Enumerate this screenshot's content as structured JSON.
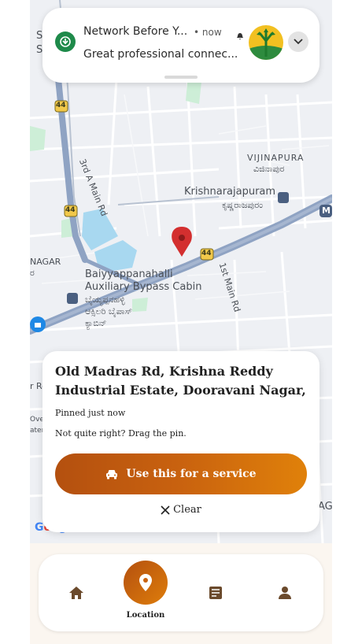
{
  "notification": {
    "app_title": "Network Before Y...",
    "time": "• now",
    "body": "Great professional connec...",
    "icon": "network-app-icon",
    "large_icon": "road-split-logo"
  },
  "map": {
    "labels": {
      "vijinapura_en": "VIJINAPURA",
      "vijinapura_kn": "ವಿಜಿನಾಪುರ",
      "krishnarajapuram_en": "Krishnarajapuram",
      "krishnarajapuram_kn": "ಕೃಷ್ಣರಾಜಪುರಂ",
      "third_a_main": "3rd A Main Rd",
      "first_main": "1st Main Rd",
      "nagar": "NAGAR",
      "nagar_kn": "ರ",
      "baiyyappanahalli_1": "Baiyyappanahalli",
      "baiyyappanahalli_2": "Auxiliary Bypass Cabin",
      "baiyyappanahalli_kn_1": "ಬೈಯ್ಯಪ್ಪನಹಳ್ಳಿ",
      "baiyyappanahalli_kn_2": "ಆಕ್ಸಿಲರಿ ಬೈಪಾಸ್",
      "baiyyappanahalli_kn_3": "ಕ್ಯಾಬಿನ್",
      "shield_44_a": "44",
      "shield_44_b": "44",
      "shield_44_c": "44",
      "metro": "M",
      "edge_r": "r Ro",
      "edge_over": "Over",
      "edge_ater": "ater",
      "edge_ag": "AG",
      "edge_s1": "S",
      "edge_s2": "S"
    },
    "google": "Google"
  },
  "card": {
    "address_line1": "Old Madras Rd, Krishna Reddy",
    "address_line2": "Industrial Estate, Dooravani Nagar, Be...",
    "pinned": "Pinned just now",
    "hint": "Not quite right? Drag the pin.",
    "cta_label": "Use this for a service",
    "clear_label": "Clear"
  },
  "nav": {
    "items": [
      {
        "name": "home",
        "icon": "home-icon"
      },
      {
        "name": "location",
        "icon": "location-pin-icon",
        "label": "Location"
      },
      {
        "name": "bookings",
        "icon": "list-icon"
      },
      {
        "name": "profile",
        "icon": "person-icon"
      }
    ]
  },
  "colors": {
    "accent": "#c05a0f",
    "pin": "#d32f2f",
    "road_major": "#8fa3c3",
    "water": "#a8d8f0",
    "park": "#cdeed7"
  }
}
